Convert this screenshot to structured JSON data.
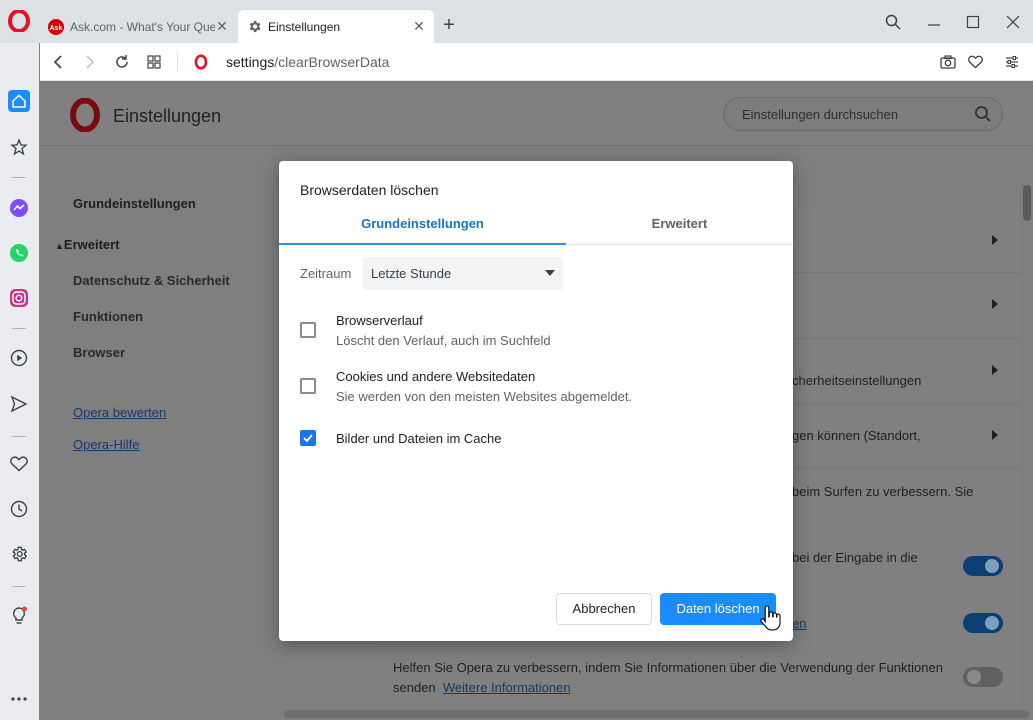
{
  "browser": {
    "tabs": [
      {
        "title": "Ask.com - What's Your Que",
        "active": false
      },
      {
        "title": "Einstellungen",
        "active": true
      }
    ],
    "address": {
      "host": "settings",
      "path": "/clearBrowserData"
    }
  },
  "settings": {
    "title": "Einstellungen",
    "search_placeholder": "Einstellungen durchsuchen",
    "nav": {
      "basic": "Grundeinstellungen",
      "advanced": "Erweitert",
      "privacy": "Datenschutz & Sicherheit",
      "features": "Funktionen",
      "browser": "Browser",
      "rate_opera": "Opera bewerten",
      "opera_help": "Opera-Hilfe"
    },
    "rows": {
      "security_settings": "cherheitseinstellungen",
      "permissions": "gen können (Standort,",
      "improve_browsing": "beim Surfen zu verbessern. Sie",
      "typing_in": "bei der Eingabe in die",
      "link_fragment": "en",
      "help_improve": "Helfen Sie Opera zu verbessern, indem Sie Informationen über die Verwendung der Funktionen",
      "send": "senden",
      "more_info": "Weitere Informationen"
    }
  },
  "dialog": {
    "title": "Browserdaten löschen",
    "tabs": {
      "basic": "Grundeinstellungen",
      "advanced": "Erweitert"
    },
    "time_range_label": "Zeitraum",
    "time_range_value": "Letzte Stunde",
    "options": [
      {
        "title": "Browserverlauf",
        "subtitle": "Löscht den Verlauf, auch im Suchfeld",
        "checked": false
      },
      {
        "title": "Cookies und andere Websitedaten",
        "subtitle": "Sie werden von den meisten Websites abgemeldet.",
        "checked": false
      },
      {
        "title": "Bilder und Dateien im Cache",
        "subtitle": "",
        "checked": true
      }
    ],
    "cancel_label": "Abbrechen",
    "confirm_label": "Daten löschen"
  },
  "colors": {
    "accent": "#1a8cff",
    "tab_active": "#1a73c8",
    "opera_red": "#e81123",
    "messenger": "#7b4dff",
    "whatsapp": "#25d366",
    "instagram": "#c13584"
  }
}
